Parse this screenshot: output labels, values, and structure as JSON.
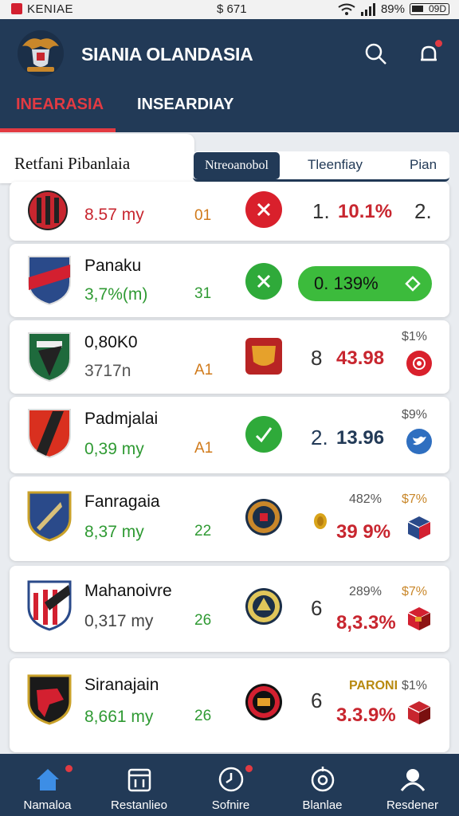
{
  "status_bar": {
    "carrier": "KENIAE",
    "center": "$ 671",
    "battery_pct": "89%",
    "battery_label": "09D"
  },
  "header": {
    "title": "SIANIA OLANDASIA",
    "tabs": [
      {
        "label": "INEARASIA",
        "active": true
      },
      {
        "label": "INSEARDIAY",
        "active": false
      }
    ],
    "accent": "#e23a42",
    "background": "#223a57"
  },
  "section": {
    "title": "Retfani Pibanlaia",
    "columns": [
      "Ntreoanobol",
      "Tleenfiay",
      "Pian"
    ]
  },
  "rows": [
    {
      "name": "",
      "value": "8.57 my",
      "code": "01",
      "num": "1.",
      "pct": "10.1%",
      "extra": "2.",
      "top_label": ""
    },
    {
      "name": "Panaku",
      "value": "3,7%(m)",
      "code": "31",
      "pill": "0. 139%"
    },
    {
      "name": "0,80K0",
      "value": "3717n",
      "code": "A1",
      "num": "8",
      "pct": "43.98",
      "top_label": "$1%"
    },
    {
      "name": "Padmjalai",
      "value": "0,39 my",
      "code": "A1",
      "num": "2.",
      "pct": "13.96",
      "top_label": "$9%"
    },
    {
      "name": "Fanragaia",
      "value": "8,37 my",
      "code": "22",
      "num": "",
      "pct": "39 9%",
      "top_label": "482%",
      "top_label2": "$7%"
    },
    {
      "name": "Mahanoivre",
      "value": "0,317 my",
      "code": "26",
      "num": "6",
      "pct": "8,3.3%",
      "top_label": "289%",
      "top_label2": "$7%"
    },
    {
      "name": "Siranajain",
      "value": "8,661 my",
      "code": "26",
      "num": "6",
      "pct": "3.3.9%",
      "top_label": "PARONI",
      "top_label2": "$1%"
    }
  ],
  "bottom_nav": [
    {
      "label": "Namaloa",
      "icon": "home-icon"
    },
    {
      "label": "Restanlieo",
      "icon": "calendar-icon"
    },
    {
      "label": "Sofnire",
      "icon": "clock-icon"
    },
    {
      "label": "Blanlae",
      "icon": "target-icon"
    },
    {
      "label": "Resdener",
      "icon": "profile-icon"
    }
  ]
}
